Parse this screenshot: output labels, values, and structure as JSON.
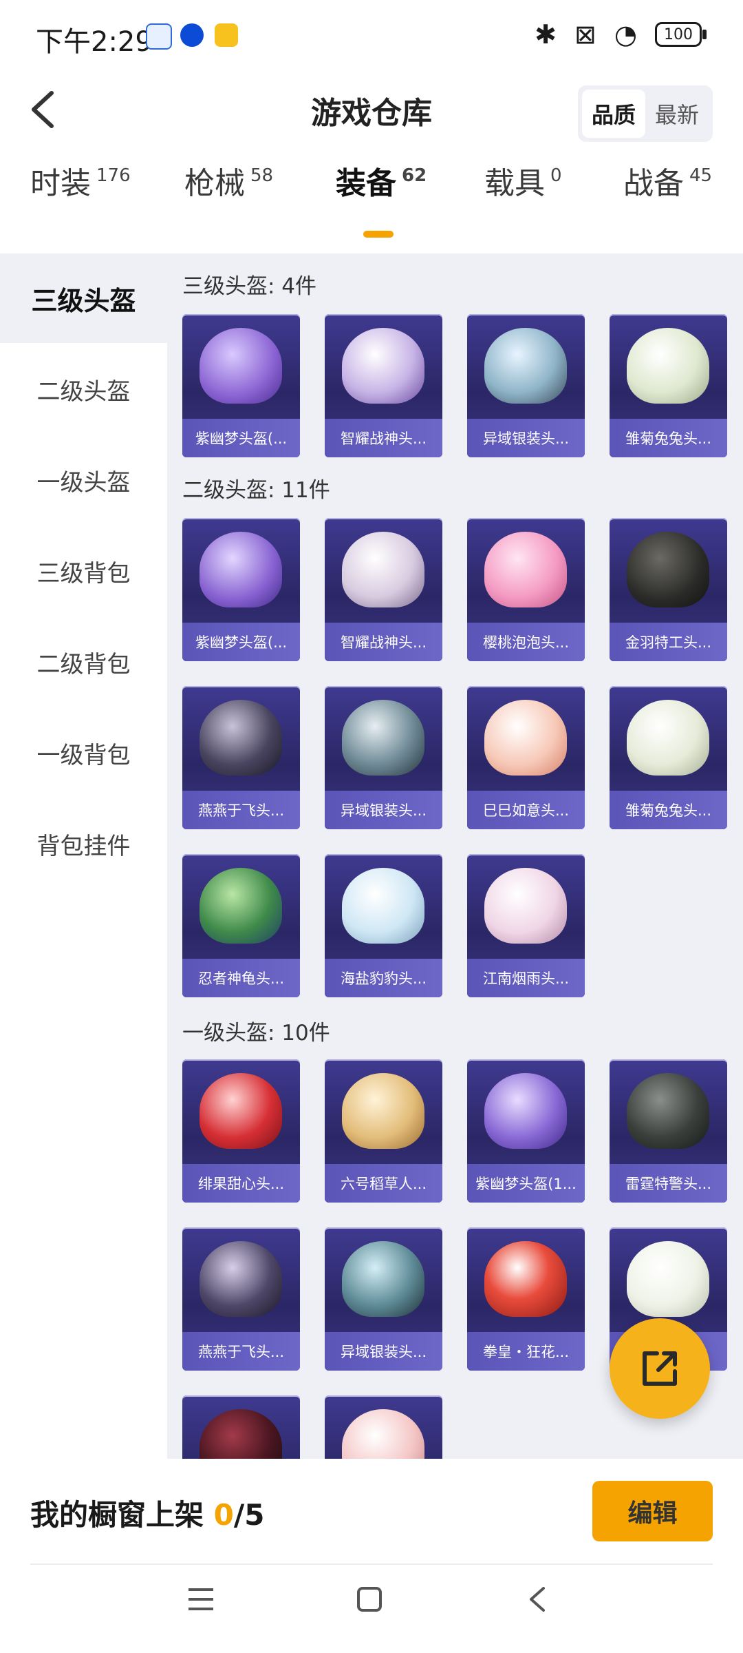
{
  "status_bar": {
    "time": "下午2:29",
    "battery": "100",
    "icons": [
      "baidu-icon",
      "bluebird-icon",
      "game-icon",
      "bluetooth-icon",
      "close-box-icon",
      "wifi-icon",
      "battery-icon"
    ]
  },
  "header": {
    "title": "游戏仓库",
    "sort_options": [
      "品质",
      "最新"
    ],
    "active_sort": "品质"
  },
  "tabs": [
    {
      "label": "时装",
      "count": "176"
    },
    {
      "label": "枪械",
      "count": "58"
    },
    {
      "label": "装备",
      "count": "62",
      "active": true
    },
    {
      "label": "载具",
      "count": "0"
    },
    {
      "label": "战备",
      "count": "45"
    }
  ],
  "sidebar": {
    "items": [
      "三级头盔",
      "二级头盔",
      "一级头盔",
      "三级背包",
      "二级背包",
      "一级背包",
      "背包挂件"
    ],
    "active": "三级头盔"
  },
  "sections": [
    {
      "title": "三级头盔: 4件",
      "items": [
        "紫幽梦头盔(...",
        "智耀战神头...",
        "异域银装头...",
        "雏菊兔兔头..."
      ]
    },
    {
      "title": "二级头盔: 11件",
      "items": [
        "紫幽梦头盔(...",
        "智耀战神头...",
        "樱桃泡泡头...",
        "金羽特工头...",
        "燕燕于飞头...",
        "异域银装头...",
        "巳巳如意头...",
        "雏菊兔兔头...",
        "忍者神龟头...",
        "海盐豹豹头...",
        "江南烟雨头..."
      ]
    },
    {
      "title": "一级头盔: 10件",
      "items": [
        "绯果甜心头...",
        "六号稻草人...",
        "紫幽梦头盔(1...",
        "雷霆特警头...",
        "燕燕于飞头...",
        "异域银装头...",
        "拳皇・狂花...",
        "",
        "",
        ""
      ]
    }
  ],
  "bottom": {
    "showcase_label": "我的橱窗上架",
    "showcase_current": "0",
    "showcase_total": "/5",
    "edit_label": "编辑"
  },
  "colors": {
    "accent": "#f5a300",
    "card_bg": "#2b2766",
    "card_label": "#6d67c8",
    "page_bg": "#eef0f6"
  }
}
